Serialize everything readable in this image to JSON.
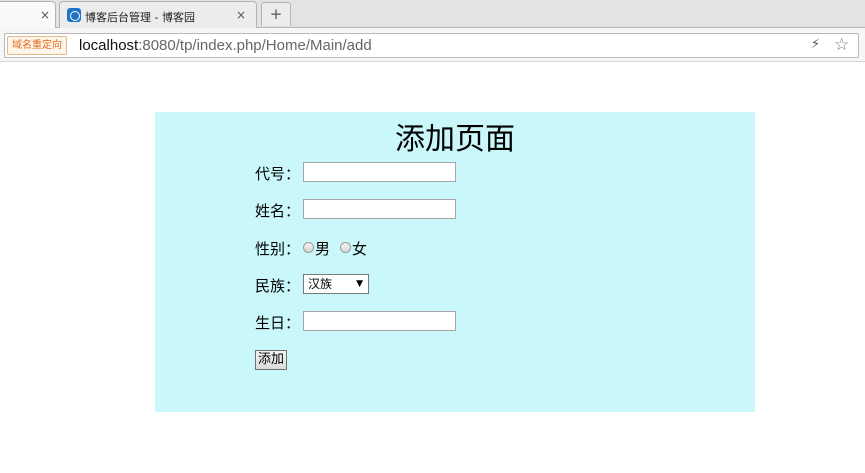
{
  "browser": {
    "tabs": [
      {
        "label": "",
        "active": true
      },
      {
        "label": "博客后台管理 - 博客园",
        "active": false
      }
    ],
    "new_tab_label": "+",
    "close_glyph": "×",
    "omnibox": {
      "badge": "域名重定向",
      "url_host": "localhost",
      "url_rest": ":8080/tp/index.php/Home/Main/add"
    },
    "icons": {
      "bolt": "bolt-icon",
      "star": "star-icon"
    }
  },
  "page": {
    "title": "添加页面",
    "background_color": "#c9f7fa",
    "fields": {
      "code": {
        "label": "代号：",
        "value": ""
      },
      "name": {
        "label": "姓名：",
        "value": ""
      },
      "gender": {
        "label": "性别：",
        "options": [
          "男",
          "女"
        ]
      },
      "nation": {
        "label": "民族：",
        "selected": "汉族"
      },
      "birthday": {
        "label": "生日：",
        "value": ""
      }
    },
    "submit_label": "添加"
  }
}
